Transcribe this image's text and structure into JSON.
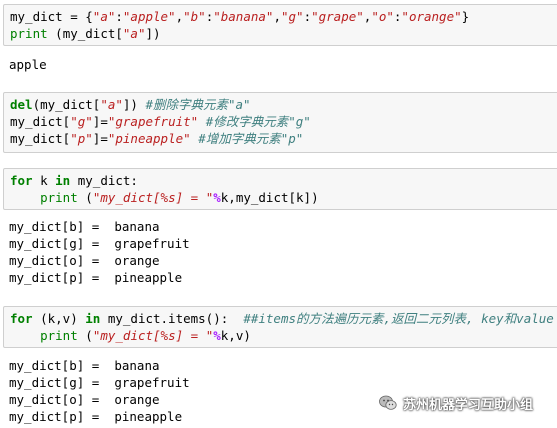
{
  "cells": [
    {
      "lines": [
        [
          [
            "my_dict = {",
            ""
          ],
          [
            "\"a\"",
            "str"
          ],
          [
            ":",
            ""
          ],
          [
            "\"apple\"",
            "str"
          ],
          [
            ",",
            ""
          ],
          [
            "\"b\"",
            "str"
          ],
          [
            ":",
            ""
          ],
          [
            "\"banana\"",
            "str"
          ],
          [
            ",",
            ""
          ],
          [
            "\"g\"",
            "str"
          ],
          [
            ":",
            ""
          ],
          [
            "\"grape\"",
            "str"
          ],
          [
            ",",
            ""
          ],
          [
            "\"o\"",
            "str"
          ],
          [
            ":",
            ""
          ],
          [
            "\"orange\"",
            "str"
          ],
          [
            "}",
            ""
          ]
        ],
        [
          [
            "print",
            "bi"
          ],
          [
            " (my_dict[",
            ""
          ],
          [
            "\"a\"",
            "str"
          ],
          [
            "])",
            ""
          ]
        ]
      ],
      "output": [
        "apple"
      ]
    },
    {
      "lines": [
        [
          [
            "del",
            "kw"
          ],
          [
            "(my_dict[",
            ""
          ],
          [
            "\"a\"",
            "str"
          ],
          [
            "]) ",
            ""
          ],
          [
            "#删除字典元素\"a\"",
            "cm"
          ]
        ],
        [
          [
            "my_dict[",
            ""
          ],
          [
            "\"g\"",
            "str"
          ],
          [
            "]=",
            ""
          ],
          [
            "\"grapefruit\"",
            "str"
          ],
          [
            " ",
            ""
          ],
          [
            "#修改字典元素\"g\"",
            "cm"
          ]
        ],
        [
          [
            "my_dict[",
            ""
          ],
          [
            "\"p\"",
            "str"
          ],
          [
            "]=",
            ""
          ],
          [
            "\"pineapple\"",
            "str"
          ],
          [
            " ",
            ""
          ],
          [
            "#增加字典元素\"p\"",
            "cm"
          ]
        ]
      ],
      "output": []
    },
    {
      "lines": [
        [
          [
            "for",
            "kw"
          ],
          [
            " k ",
            ""
          ],
          [
            "in",
            "kw"
          ],
          [
            " my_dict:",
            ""
          ]
        ],
        [
          [
            "    ",
            ""
          ],
          [
            "print",
            "bi"
          ],
          [
            " (",
            ""
          ],
          [
            "\"my_dict[%s] = \"",
            "str"
          ],
          [
            "%",
            "op"
          ],
          [
            "k,my_dict[k])",
            ""
          ]
        ]
      ],
      "output": [
        "my_dict[b] =  banana",
        "my_dict[g] =  grapefruit",
        "my_dict[o] =  orange",
        "my_dict[p] =  pineapple"
      ]
    },
    {
      "lines": [
        [
          [
            "for",
            "kw"
          ],
          [
            " (k,v) ",
            ""
          ],
          [
            "in",
            "kw"
          ],
          [
            " my_dict.items():  ",
            ""
          ],
          [
            "##items的方法遍历元素,返回二元列表, key和value",
            "cm"
          ]
        ],
        [
          [
            "    ",
            ""
          ],
          [
            "print",
            "bi"
          ],
          [
            " (",
            ""
          ],
          [
            "\"my_dict[%s] = \"",
            "str"
          ],
          [
            "%",
            "op"
          ],
          [
            "k,v)",
            ""
          ]
        ]
      ],
      "output": [
        "my_dict[b] =  banana",
        "my_dict[g] =  grapefruit",
        "my_dict[o] =  orange",
        "my_dict[p] =  pineapple"
      ]
    }
  ],
  "watermark": {
    "text": "苏州机器学习互助小组",
    "icon": "wechat-icon"
  }
}
